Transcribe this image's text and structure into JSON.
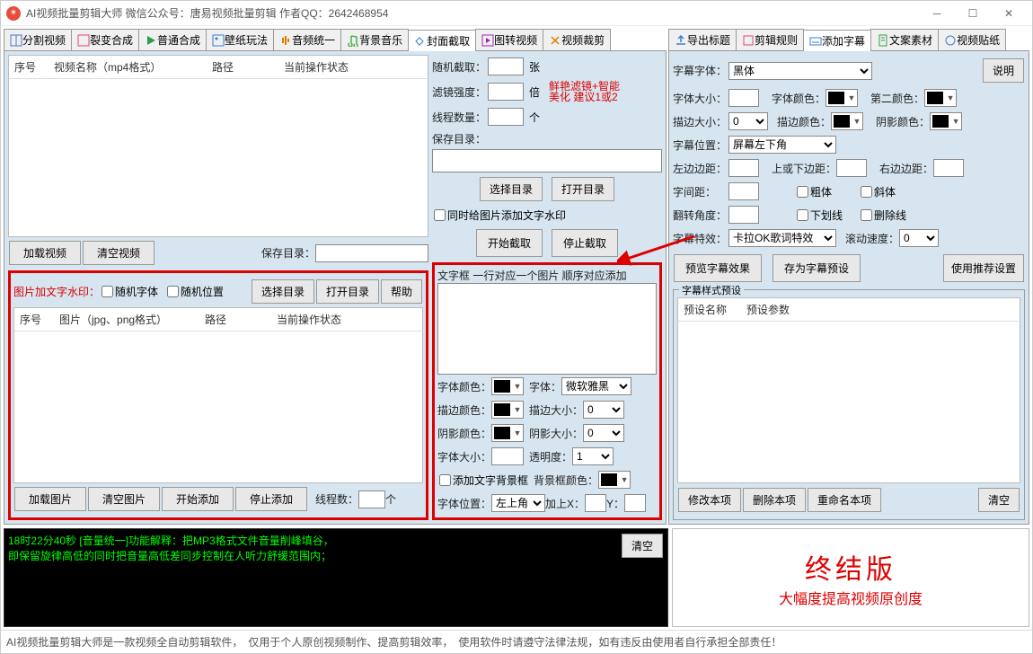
{
  "title": "AI视频批量剪辑大师    微信公众号：唐易视频批量剪辑     作者QQ：2642468954",
  "main_tabs": [
    "分割视频",
    "裂变合成",
    "普通合成",
    "壁纸玩法",
    "音频统一",
    "背景音乐",
    "封面截取",
    "图转视频",
    "视频裁剪"
  ],
  "main_tab_active": 6,
  "right_tabs": [
    "导出标题",
    "剪辑规则",
    "添加字幕",
    "文案素材",
    "视频贴纸"
  ],
  "right_tab_active": 2,
  "video_list": {
    "headers": [
      "序号",
      "视频名称（mp4格式）",
      "路径",
      "当前操作状态"
    ]
  },
  "img_list": {
    "headers": [
      "序号",
      "图片（jpg、png格式）",
      "路径",
      "当前操作状态"
    ]
  },
  "buttons": {
    "load_video": "加载视频",
    "clear_video": "清空视频",
    "save_dir_label": "保存目录：",
    "select_dir": "选择目录",
    "open_dir": "打开目录",
    "help": "帮助",
    "start_crop": "开始截取",
    "stop_crop": "停止截取",
    "load_img": "加载图片",
    "clear_img": "清空图片",
    "start_add": "开始添加",
    "stop_add": "停止添加",
    "preview_sub": "预览字幕效果",
    "save_preset": "存为字幕预设",
    "use_reco": "使用推荐设置",
    "mod_item": "修改本项",
    "del_item": "删除本项",
    "rename_item": "重命名本项",
    "clear_all": "清空",
    "desc_btn": "说明",
    "log_clear": "清空"
  },
  "labels": {
    "watermark_section": "图片加文字水印：",
    "rand_font": "随机字体",
    "rand_pos": "随机位置",
    "thread_count": "线程数：",
    "thread_unit": "个",
    "rand_crop": "随机截取：",
    "crop_unit": "张",
    "filter_strength": "滤镜强度：",
    "filter_unit": "倍",
    "filter_hint1": "鲜艳滤镜+智能",
    "filter_hint2": "美化 建议1或2",
    "thread_num": "线程数量：",
    "thread_num_unit": "个",
    "save_dir2": "保存目录：",
    "add_wm_chk": "同时给图片添加文字水印",
    "textbox_hint": "文字框 一行对应一个图片 顺序对应添加",
    "font_color": "字体颜色：",
    "font": "字体：",
    "font_val": "微软雅黑",
    "stroke_color": "描边颜色：",
    "stroke_size": "描边大小：",
    "shadow_color": "阴影颜色：",
    "shadow_size": "阴影大小：",
    "font_size": "字体大小：",
    "opacity": "透明度：",
    "add_bg": "添加文字背景框",
    "bg_color": "背景框颜色：",
    "font_pos": "字体位置：",
    "pos_val": "左上角",
    "addx": "加上X：",
    "addy": "Y：",
    "sub_font": "字幕字体：",
    "sub_font_val": "黑体",
    "sub_size": "字体大小：",
    "sub_color": "字体颜色：",
    "color2": "第二颜色：",
    "sub_stroke": "描边大小：",
    "sub_stroke_color": "描边颜色：",
    "sub_shadow_color": "阴影颜色：",
    "sub_pos": "字幕位置：",
    "sub_pos_val": "屏幕左下角",
    "left_margin": "左边边距：",
    "top_margin": "上或下边距：",
    "right_margin": "右边边距：",
    "char_space": "字间距：",
    "bold": "粗体",
    "italic": "斜体",
    "rotate": "翻转角度：",
    "underline": "下划线",
    "strike": "删除线",
    "sub_fx": "字幕特效：",
    "sub_fx_val": "卡拉OK歌词特效",
    "scroll_speed": "滚动速度：",
    "preset_section": "字幕样式预设",
    "preset_headers": [
      "预设名称",
      "预设参数"
    ]
  },
  "values": {
    "stroke_size": "0",
    "shadow_size": "0",
    "opacity": "1",
    "sub_stroke": "0",
    "scroll_speed": "0"
  },
  "log": {
    "line1": "18时22分40秒 [音量统一]功能解释：把MP3格式文件音量削峰填谷，",
    "line2": "       即保留旋律高低的同时把音量高低差同步控制在人听力舒缓范围内；"
  },
  "brand": {
    "big": "终结版",
    "sub": "大幅度提高视频原创度"
  },
  "footer": "AI视频批量剪辑大师是一款视频全自动剪辑软件，　仅用于个人原创视频制作、提高剪辑效率，　使用软件时请遵守法律法规，如有违反由使用者自行承担全部责任！"
}
